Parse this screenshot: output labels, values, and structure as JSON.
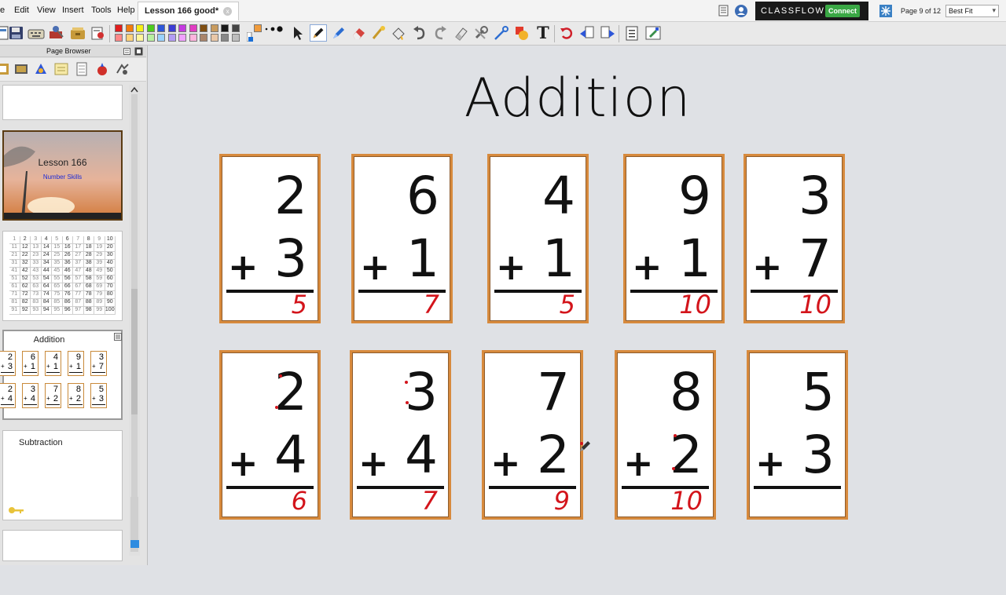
{
  "menu": {
    "items": [
      "e",
      "Edit",
      "View",
      "Insert",
      "Tools",
      "Help"
    ],
    "doc_tab": "Lesson 166 good*",
    "tab_close": "x"
  },
  "classflow": {
    "label": "CLASSFLOW",
    "connect": "Connect"
  },
  "page_indicator": "Page 9 of 12",
  "fit_select": {
    "value": "Best Fit"
  },
  "toolbar": {
    "palette": [
      "#e11d1d",
      "#f37c0c",
      "#f6ef16",
      "#4ccc1c",
      "#2d56d8",
      "#3d3dd4",
      "#c43ae0",
      "#e13cc2",
      "#7f4e12",
      "#c89b5e",
      "#1a1a1a",
      "#444444",
      "#ff8888",
      "#ffd27a",
      "#fff59a",
      "#b7f0a0",
      "#9ad2ff",
      "#b39cf5",
      "#f0a0ff",
      "#ffb3dd",
      "#a9846a",
      "#e9c7a7",
      "#888888",
      "#bdbdbd"
    ],
    "text_icon": "T"
  },
  "page_browser": {
    "title": "Page Browser",
    "thumb_lesson": {
      "title": "Lesson 166",
      "subtitle": "Number Skills"
    },
    "thumb_grid": {
      "rows": [
        [
          "1",
          "2",
          "3",
          "4",
          "5",
          "6",
          "7",
          "8",
          "9",
          "10"
        ],
        [
          "11",
          "12",
          "13",
          "14",
          "15",
          "16",
          "17",
          "18",
          "19",
          "20"
        ],
        [
          "21",
          "22",
          "23",
          "24",
          "25",
          "26",
          "27",
          "28",
          "29",
          "30"
        ],
        [
          "31",
          "32",
          "33",
          "34",
          "35",
          "36",
          "37",
          "38",
          "39",
          "40"
        ],
        [
          "41",
          "42",
          "43",
          "44",
          "45",
          "46",
          "47",
          "48",
          "49",
          "50"
        ],
        [
          "51",
          "52",
          "53",
          "54",
          "55",
          "56",
          "57",
          "58",
          "59",
          "60"
        ],
        [
          "61",
          "62",
          "63",
          "64",
          "65",
          "66",
          "67",
          "68",
          "69",
          "70"
        ],
        [
          "71",
          "72",
          "73",
          "74",
          "75",
          "76",
          "77",
          "78",
          "79",
          "80"
        ],
        [
          "81",
          "82",
          "83",
          "84",
          "85",
          "86",
          "87",
          "88",
          "89",
          "90"
        ],
        [
          "91",
          "92",
          "93",
          "94",
          "95",
          "96",
          "97",
          "98",
          "99",
          "100"
        ]
      ]
    },
    "thumb_addition": {
      "title": "Addition",
      "row1": [
        [
          "2",
          "3"
        ],
        [
          "6",
          "1"
        ],
        [
          "4",
          "1"
        ],
        [
          "9",
          "1"
        ],
        [
          "3",
          "7"
        ]
      ],
      "row2": [
        [
          "2",
          "4"
        ],
        [
          "3",
          "4"
        ],
        [
          "7",
          "2"
        ],
        [
          "8",
          "2"
        ],
        [
          "5",
          "3"
        ]
      ]
    },
    "thumb_subtraction": {
      "title": "Subtraction"
    }
  },
  "page": {
    "title": "Addition",
    "cards": [
      {
        "top": "2",
        "bottom": "3",
        "answer": "5"
      },
      {
        "top": "6",
        "bottom": "1",
        "answer": "7"
      },
      {
        "top": "4",
        "bottom": "1",
        "answer": "5"
      },
      {
        "top": "9",
        "bottom": "1",
        "answer": "10"
      },
      {
        "top": "3",
        "bottom": "7",
        "answer": "10"
      },
      {
        "top": "2",
        "bottom": "4",
        "answer": "6"
      },
      {
        "top": "3",
        "bottom": "4",
        "answer": "7"
      },
      {
        "top": "7",
        "bottom": "2",
        "answer": "9"
      },
      {
        "top": "8",
        "bottom": "2",
        "answer": "10"
      },
      {
        "top": "5",
        "bottom": "3",
        "answer": ""
      }
    ],
    "plus_sign": "+"
  }
}
